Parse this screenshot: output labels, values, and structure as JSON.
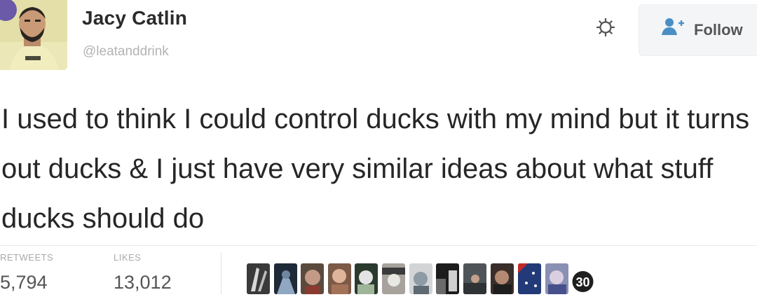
{
  "tweet": {
    "author": {
      "name": "Jacy Catlin",
      "handle": "@leatanddrink"
    },
    "follow_label": "Follow",
    "text": "I used to think I could control ducks with my mind but it turns out ducks & I just have very similar ideas about what stuff ducks should do",
    "stats": {
      "retweets_label": "RETWEETS",
      "retweets_value": "5,794",
      "likes_label": "LIKES",
      "likes_value": "13,012"
    },
    "likers_badge": "30"
  },
  "icons": [
    "gear-icon",
    "person-add-icon"
  ],
  "colors": {
    "name": "#2b2b2b",
    "handle": "#b3b3b3",
    "body_text": "#262626",
    "button_bg": "#f3f5f7"
  }
}
